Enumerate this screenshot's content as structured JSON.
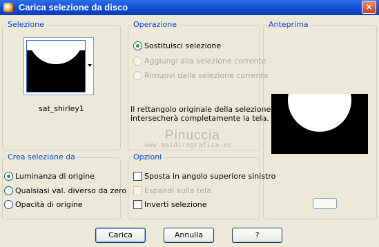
{
  "window": {
    "title": "Carica selezione da disco",
    "close_label": "×"
  },
  "selection_group": {
    "title": "Selezione",
    "selected_name": "sat_shirley1"
  },
  "operation_group": {
    "title": "Operazione",
    "options": [
      {
        "label": "Sostituisci selezione",
        "checked": true,
        "enabled": true
      },
      {
        "label": "Aggiungi alla selezione corrente",
        "checked": false,
        "enabled": false
      },
      {
        "label": "Rimuovi dalla selezione corrente",
        "checked": false,
        "enabled": false
      }
    ],
    "info_line1": "Il rettangolo originale della selezione",
    "info_line2": "intersecherà completamente la tela."
  },
  "watermark": {
    "name": "Pinuccia",
    "url": "www.maidiregrafica.eu"
  },
  "preview_group": {
    "title": "Anteprima"
  },
  "create_group": {
    "title": "Crea selezione da",
    "options": [
      {
        "label": "Luminanza di origine",
        "checked": true
      },
      {
        "label": "Qualsiasi val. diverso da zero",
        "checked": false
      },
      {
        "label": "Opacità di origine",
        "checked": false
      }
    ]
  },
  "options_group": {
    "title": "Opzioni",
    "checks": [
      {
        "label": "Sposta in angolo superiore sinistro",
        "checked": false,
        "enabled": true
      },
      {
        "label": "Espandi sulla tela",
        "checked": false,
        "enabled": false
      },
      {
        "label": "Inverti selezione",
        "checked": false,
        "enabled": true
      }
    ]
  },
  "buttons": {
    "load": "Carica",
    "cancel": "Annulla",
    "help": "?"
  },
  "icons": {
    "app": "paint-shop-icon",
    "close": "close-icon",
    "dropdown": "chevron-down-icon"
  }
}
